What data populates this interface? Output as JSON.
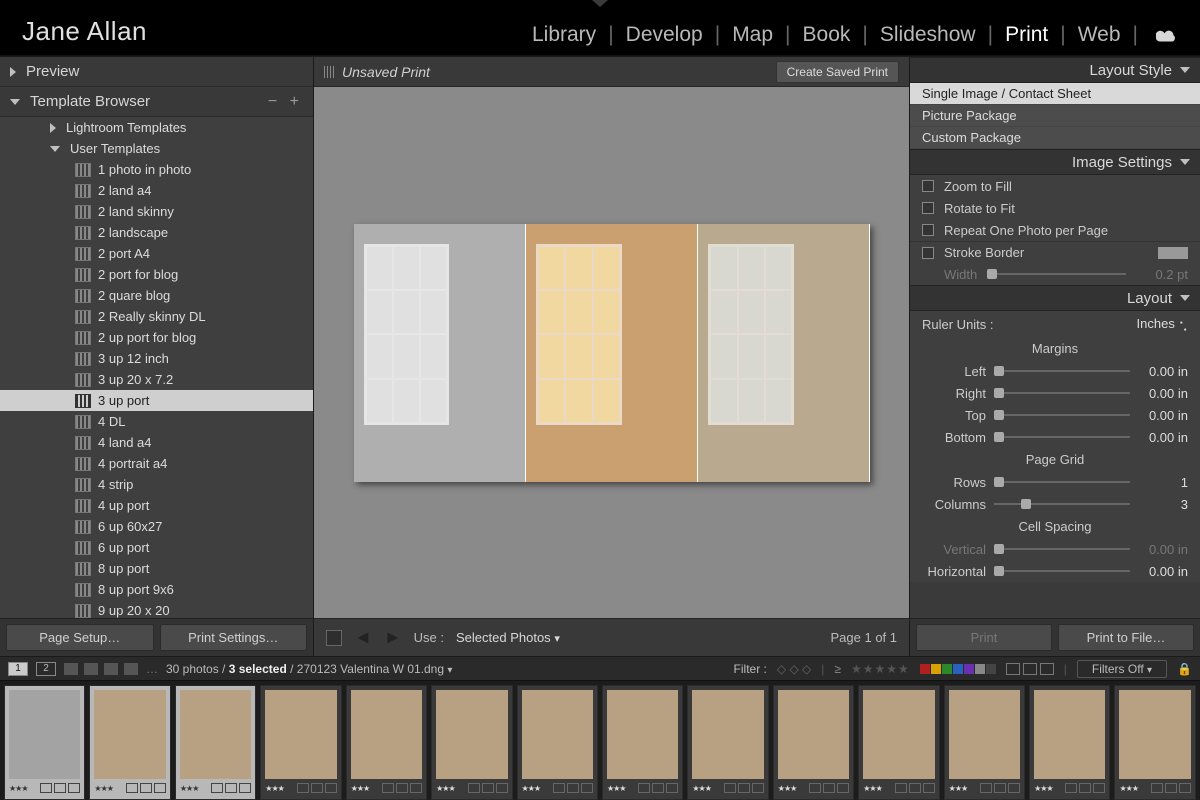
{
  "header": {
    "identity": "Jane Allan",
    "modules": [
      "Library",
      "Develop",
      "Map",
      "Book",
      "Slideshow",
      "Print",
      "Web"
    ],
    "active_module": "Print"
  },
  "left": {
    "preview_title": "Preview",
    "browser_title": "Template Browser",
    "folders": {
      "lightroom": "Lightroom Templates",
      "user": "User Templates"
    },
    "templates": [
      "1 photo in photo",
      "2 land a4",
      "2 land skinny",
      "2 landscape",
      "2 port A4",
      "2 port for blog",
      "2 quare blog",
      "2 Really skinny DL",
      "2 up port for blog",
      "3 up 12 inch",
      "3 up 20 x 7.2",
      "3 up port",
      "4 DL",
      "4 land a4",
      "4 portrait a4",
      "4 strip",
      "4 up port",
      "6 up 60x27",
      "6 up port",
      "8 up port",
      "8 up port 9x6",
      "9 up 20 x 20"
    ],
    "selected_template": "3 up port",
    "buttons": {
      "page_setup": "Page Setup…",
      "print_settings": "Print Settings…"
    }
  },
  "center": {
    "title": "Unsaved Print",
    "create_saved": "Create Saved Print",
    "use_label": "Use :",
    "use_value": "Selected Photos",
    "pager": "Page 1 of 1"
  },
  "right": {
    "sections": {
      "layout_style": "Layout Style",
      "image_settings": "Image Settings",
      "layout": "Layout"
    },
    "layout_style_opts": [
      "Single Image / Contact Sheet",
      "Picture Package",
      "Custom Package"
    ],
    "layout_style_selected": "Single Image / Contact Sheet",
    "image_settings": {
      "zoom": "Zoom to Fill",
      "rotate": "Rotate to Fit",
      "repeat": "Repeat One Photo per Page",
      "stroke": "Stroke Border",
      "width_label": "Width",
      "width_val": "0.2 pt"
    },
    "layout_panel": {
      "ruler_label": "Ruler Units :",
      "ruler_value": "Inches",
      "margins_head": "Margins",
      "margins": {
        "Left": "0.00 in",
        "Right": "0.00 in",
        "Top": "0.00 in",
        "Bottom": "0.00 in"
      },
      "grid_head": "Page Grid",
      "grid": {
        "Rows": "1",
        "Columns": "3"
      },
      "spacing_head": "Cell Spacing",
      "spacing": {
        "Vertical": "0.00 in",
        "Horizontal": "0.00 in"
      }
    },
    "buttons": {
      "print": "Print",
      "print_file": "Print to File…"
    }
  },
  "strip": {
    "monitors": [
      "1",
      "2"
    ],
    "count_text": "30 photos /",
    "selected_text": "3 selected",
    "filename": "/ 270123 Valentina W 01.dng",
    "filter_label": "Filter :",
    "filters_off": "Filters Off",
    "swatches": [
      "#b02020",
      "#d8a000",
      "#2a8a2a",
      "#2a60c0",
      "#6a30b0",
      "#888",
      "#444"
    ],
    "thumbs": [
      {
        "bw": true,
        "sel": true
      },
      {
        "bw": false,
        "sel": true
      },
      {
        "bw": false,
        "sel": true
      },
      {
        "bw": false,
        "sel": false
      },
      {
        "bw": false,
        "sel": false
      },
      {
        "bw": false,
        "sel": false
      },
      {
        "bw": false,
        "sel": false
      },
      {
        "bw": false,
        "sel": false
      },
      {
        "bw": false,
        "sel": false
      },
      {
        "bw": false,
        "sel": false
      },
      {
        "bw": false,
        "sel": false
      },
      {
        "bw": false,
        "sel": false
      },
      {
        "bw": false,
        "sel": false
      },
      {
        "bw": false,
        "sel": false
      }
    ]
  }
}
